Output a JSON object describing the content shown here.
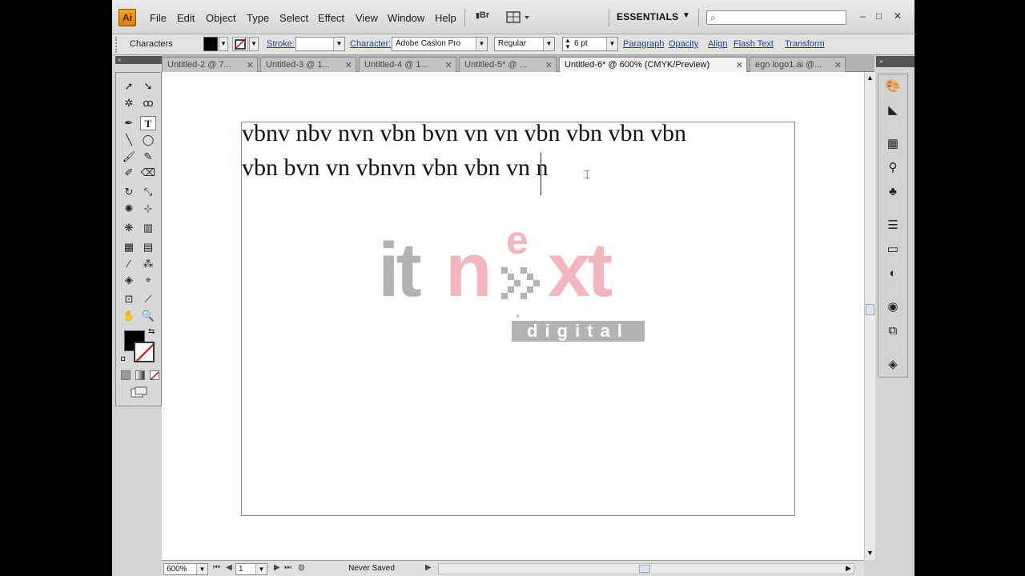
{
  "app": {
    "logo": "Ai"
  },
  "menu": [
    "File",
    "Edit",
    "Object",
    "Type",
    "Select",
    "Effect",
    "View",
    "Window",
    "Help"
  ],
  "bridge_label": "Br",
  "workspace": "ESSENTIALS",
  "window_buttons": {
    "minimize": "–",
    "restore": "□",
    "close": "✕"
  },
  "control": {
    "selection_label": "Characters",
    "stroke_label": "Stroke:",
    "character_label": "Character:",
    "font_family": "Adobe Caslon Pro",
    "font_style": "Regular",
    "font_size": "6 pt",
    "links": [
      "Paragraph",
      "Opacity",
      "Align",
      "Flash Text",
      "Transform"
    ]
  },
  "tabs": [
    {
      "label": "Untitled-2 @ 7...",
      "active": false
    },
    {
      "label": "Untitled-3 @ 1...",
      "active": false
    },
    {
      "label": "Untitled-4 @ 1...",
      "active": false
    },
    {
      "label": "Untitled-5* @ ...",
      "active": false
    },
    {
      "label": "Untitled-6* @ 600% (CMYK/Preview)",
      "active": true
    },
    {
      "label": "egn logo1.ai @...",
      "active": false
    }
  ],
  "document": {
    "line1": "vbnv nbv nvn vbn bvn vn vn vbn vbn vbn vbn",
    "line2": "vbn bvn vn vbnvn vbn vbn vn n"
  },
  "logo": {
    "it": "it",
    "n": "n",
    "e": "e",
    "xt": "xt",
    "digital": "digital",
    "gray": "#b3b3b3",
    "pink": "#f4b6bd"
  },
  "status": {
    "zoom": "600%",
    "artboard": "1",
    "save_state": "Never Saved"
  },
  "colors": {
    "accent_link": "#1d3fa8",
    "fill": "#000000",
    "stroke": "none"
  }
}
